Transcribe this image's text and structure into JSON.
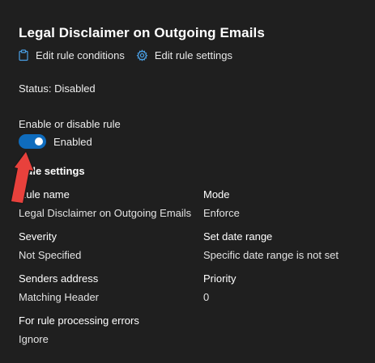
{
  "panel": {
    "title": "Legal Disclaimer on Outgoing Emails",
    "actions": [
      {
        "label": "Edit rule conditions",
        "icon": "clipboard-edit-icon"
      },
      {
        "label": "Edit rule settings",
        "icon": "gear-icon"
      }
    ],
    "status": "Status: Disabled"
  },
  "toggle": {
    "heading": "Enable or disable rule",
    "state_label": "Enabled",
    "on": true,
    "accent_color": "#0f6cbd"
  },
  "settings": {
    "heading": "Rule settings",
    "fields": [
      {
        "label": "Rule name",
        "value": "Legal Disclaimer on Outgoing Emails"
      },
      {
        "label": "Mode",
        "value": "Enforce"
      },
      {
        "label": "Severity",
        "value": "Not Specified"
      },
      {
        "label": "Set date range",
        "value": "Specific date range is not set"
      },
      {
        "label": "Senders address",
        "value": "Matching Header"
      },
      {
        "label": "Priority",
        "value": "0"
      },
      {
        "label": "For rule processing errors",
        "value": "Ignore"
      }
    ]
  },
  "annotation": {
    "icon": "red-arrow-icon",
    "color": "#e8413c"
  }
}
